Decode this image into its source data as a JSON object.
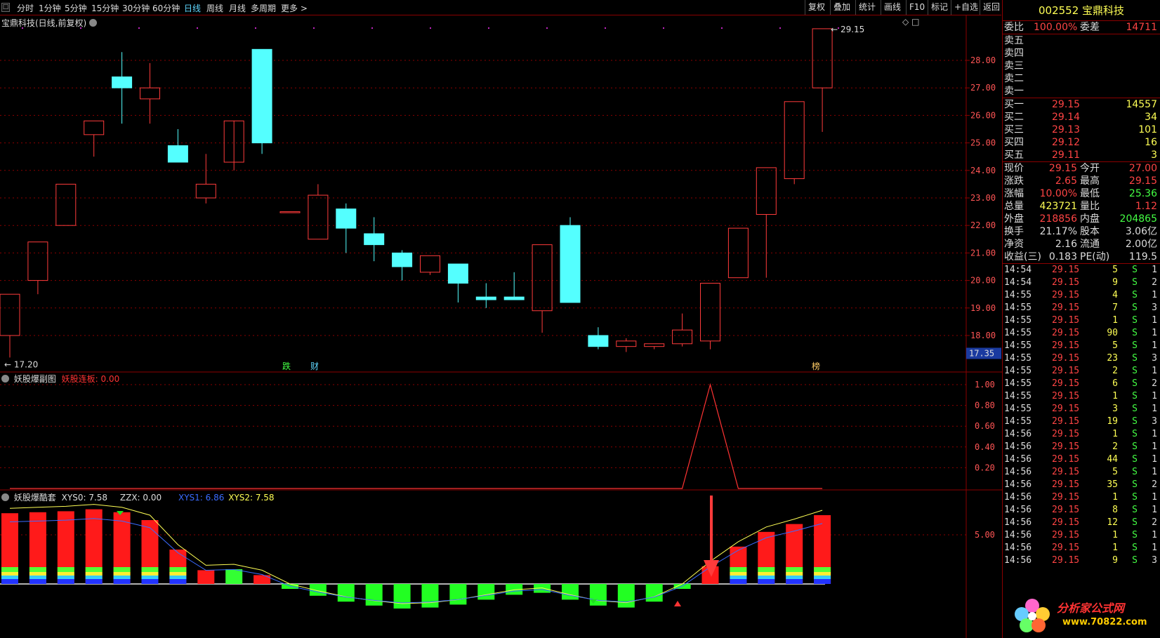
{
  "toolbar": {
    "grip": "□",
    "periods": [
      {
        "label": "分时",
        "active": false
      },
      {
        "label": "1分钟",
        "active": false
      },
      {
        "label": "5分钟",
        "active": false
      },
      {
        "label": "15分钟",
        "active": false
      },
      {
        "label": "30分钟",
        "active": false
      },
      {
        "label": "60分钟",
        "active": false
      },
      {
        "label": "日线",
        "active": true
      },
      {
        "label": "周线",
        "active": false
      },
      {
        "label": "月线",
        "active": false
      },
      {
        "label": "多周期",
        "active": false
      },
      {
        "label": "更多 >",
        "active": false
      }
    ],
    "tools": [
      "复权",
      "叠加",
      "统计",
      "画线",
      "F10",
      "标记",
      "+自选",
      "返回"
    ]
  },
  "main_chart": {
    "title": "宝鼎科技(日线,前复权)",
    "price_ticks": [
      "28.00",
      "27.00",
      "26.00",
      "25.00",
      "24.00",
      "23.00",
      "22.00",
      "21.00",
      "20.00",
      "19.00",
      "18.00"
    ],
    "current_price_tag": "17.35",
    "high_label": "29.15",
    "low_label": "17.20",
    "markers": [
      {
        "text": "跌",
        "color": "#44ff44"
      },
      {
        "text": "财",
        "color": "#5fd7ff"
      },
      {
        "text": "榜",
        "color": "#ffcc66"
      }
    ],
    "corner_icons": [
      "◇",
      "□"
    ]
  },
  "sub_chart1": {
    "name": "妖股爆副图",
    "series_label": "妖股连板: 0.00",
    "ticks": [
      "1.00",
      "0.80",
      "0.60",
      "0.40",
      "0.20"
    ]
  },
  "sub_chart2": {
    "name": "妖股爆酷套",
    "xys0": "XYS0: 7.58",
    "zzx": "ZZX: 0.00",
    "xys1": "XYS1: 6.86",
    "xys2": "XYS2: 7.58",
    "ticks": [
      "5.00"
    ]
  },
  "colors": {
    "up": "#ff3b3b",
    "down": "#54ffff",
    "grid": "#8b0000",
    "axis_text": "#ff5555"
  },
  "chart_data": {
    "type": "candlestick",
    "title": "宝鼎科技(日线,前复权)",
    "ylim": [
      17.0,
      29.5
    ],
    "candles": [
      {
        "o": 18.0,
        "h": 19.5,
        "l": 17.2,
        "c": 19.5
      },
      {
        "o": 20.0,
        "h": 21.4,
        "l": 19.5,
        "c": 21.4
      },
      {
        "o": 22.0,
        "h": 23.5,
        "l": 22.0,
        "c": 23.5
      },
      {
        "o": 25.3,
        "h": 25.8,
        "l": 24.5,
        "c": 25.8
      },
      {
        "o": 27.4,
        "h": 28.3,
        "l": 25.7,
        "c": 27.0
      },
      {
        "o": 26.6,
        "h": 27.9,
        "l": 25.7,
        "c": 27.0
      },
      {
        "o": 24.9,
        "h": 25.5,
        "l": 24.3,
        "c": 24.3
      },
      {
        "o": 23.0,
        "h": 24.6,
        "l": 22.8,
        "c": 23.5
      },
      {
        "o": 24.3,
        "h": 24.3,
        "l": 24.0,
        "c": 25.8
      },
      {
        "o": 28.4,
        "h": 28.4,
        "l": 24.6,
        "c": 25.0
      },
      {
        "o": 22.5,
        "h": 22.5,
        "l": 22.5,
        "c": 22.5
      },
      {
        "o": 21.5,
        "h": 23.5,
        "l": 21.5,
        "c": 23.1
      },
      {
        "o": 22.6,
        "h": 22.8,
        "l": 21.0,
        "c": 21.9
      },
      {
        "o": 21.7,
        "h": 22.3,
        "l": 20.7,
        "c": 21.3
      },
      {
        "o": 21.0,
        "h": 21.1,
        "l": 20.0,
        "c": 20.5
      },
      {
        "o": 20.3,
        "h": 20.9,
        "l": 20.2,
        "c": 20.9
      },
      {
        "o": 20.6,
        "h": 20.6,
        "l": 19.2,
        "c": 19.9
      },
      {
        "o": 19.4,
        "h": 19.9,
        "l": 19.0,
        "c": 19.3
      },
      {
        "o": 19.4,
        "h": 20.3,
        "l": 19.3,
        "c": 19.3
      },
      {
        "o": 18.9,
        "h": 21.3,
        "l": 18.1,
        "c": 21.3
      },
      {
        "o": 22.0,
        "h": 22.3,
        "l": 19.2,
        "c": 19.2
      },
      {
        "o": 18.0,
        "h": 18.3,
        "l": 17.5,
        "c": 17.6
      },
      {
        "o": 17.6,
        "h": 17.9,
        "l": 17.4,
        "c": 17.8
      },
      {
        "o": 17.6,
        "h": 17.7,
        "l": 17.5,
        "c": 17.7
      },
      {
        "o": 17.7,
        "h": 18.8,
        "l": 17.6,
        "c": 18.2
      },
      {
        "o": 17.8,
        "h": 19.9,
        "l": 17.5,
        "c": 19.9
      },
      {
        "o": 20.1,
        "h": 21.9,
        "l": 20.1,
        "c": 21.9
      },
      {
        "o": 22.4,
        "h": 24.1,
        "l": 20.1,
        "c": 24.1
      },
      {
        "o": 23.7,
        "h": 26.5,
        "l": 23.5,
        "c": 26.5
      },
      {
        "o": 27.0,
        "h": 29.15,
        "l": 25.4,
        "c": 29.15
      }
    ],
    "sub1_line": [
      0,
      0,
      0,
      0,
      0,
      0,
      0,
      0,
      0,
      0,
      0,
      0,
      0,
      0,
      0,
      0,
      0,
      0,
      0,
      0,
      0,
      0,
      0,
      0,
      0,
      1.0,
      0,
      0,
      0,
      0
    ],
    "sub2_bars": [
      {
        "v": 7.2,
        "color": "red"
      },
      {
        "v": 7.3,
        "color": "red"
      },
      {
        "v": 7.4,
        "color": "red"
      },
      {
        "v": 7.6,
        "color": "red"
      },
      {
        "v": 7.3,
        "color": "red"
      },
      {
        "v": 6.5,
        "color": "red"
      },
      {
        "v": 3.5,
        "color": "red"
      },
      {
        "v": 1.4,
        "color": "red"
      },
      {
        "v": 1.5,
        "color": "green"
      },
      {
        "v": 0.9,
        "color": "red"
      },
      {
        "v": -0.5,
        "color": "green"
      },
      {
        "v": -1.2,
        "color": "green"
      },
      {
        "v": -1.8,
        "color": "green"
      },
      {
        "v": -2.2,
        "color": "green"
      },
      {
        "v": -2.5,
        "color": "green"
      },
      {
        "v": -2.4,
        "color": "green"
      },
      {
        "v": -2.1,
        "color": "green"
      },
      {
        "v": -1.6,
        "color": "green"
      },
      {
        "v": -1.1,
        "color": "green"
      },
      {
        "v": -0.9,
        "color": "green"
      },
      {
        "v": -1.6,
        "color": "green"
      },
      {
        "v": -2.2,
        "color": "green"
      },
      {
        "v": -2.4,
        "color": "green"
      },
      {
        "v": -1.8,
        "color": "green"
      },
      {
        "v": -0.5,
        "color": "green"
      },
      {
        "v": 1.8,
        "color": "red"
      },
      {
        "v": 3.8,
        "color": "red"
      },
      {
        "v": 5.3,
        "color": "red"
      },
      {
        "v": 6.1,
        "color": "red"
      },
      {
        "v": 7.0,
        "color": "red"
      }
    ]
  },
  "quote": {
    "title": "002552 宝鼎科技",
    "weibi_label": "委比",
    "weibi": "100.00%",
    "weicha_label": "委差",
    "weicha": "14711",
    "asks": [
      {
        "label": "卖五",
        "price": "",
        "vol": ""
      },
      {
        "label": "卖四",
        "price": "",
        "vol": ""
      },
      {
        "label": "卖三",
        "price": "",
        "vol": ""
      },
      {
        "label": "卖二",
        "price": "",
        "vol": ""
      },
      {
        "label": "卖一",
        "price": "",
        "vol": ""
      }
    ],
    "bids": [
      {
        "label": "买一",
        "price": "29.15",
        "vol": "14557"
      },
      {
        "label": "买二",
        "price": "29.14",
        "vol": "34"
      },
      {
        "label": "买三",
        "price": "29.13",
        "vol": "101"
      },
      {
        "label": "买四",
        "price": "29.12",
        "vol": "16"
      },
      {
        "label": "买五",
        "price": "29.11",
        "vol": "3"
      }
    ],
    "stats": [
      {
        "l1": "现价",
        "v1": "29.15",
        "c1": "red",
        "l2": "今开",
        "v2": "27.00",
        "c2": "red"
      },
      {
        "l1": "涨跌",
        "v1": "2.65",
        "c1": "red",
        "l2": "最高",
        "v2": "29.15",
        "c2": "red"
      },
      {
        "l1": "涨幅",
        "v1": "10.00%",
        "c1": "red",
        "l2": "最低",
        "v2": "25.36",
        "c2": "green"
      },
      {
        "l1": "总量",
        "v1": "423721",
        "c1": "yellow",
        "l2": "量比",
        "v2": "1.12",
        "c2": "red"
      },
      {
        "l1": "外盘",
        "v1": "218856",
        "c1": "red",
        "l2": "内盘",
        "v2": "204865",
        "c2": "green"
      },
      {
        "l1": "换手",
        "v1": "21.17%",
        "c1": "white",
        "l2": "股本",
        "v2": "3.06亿",
        "c2": "white"
      },
      {
        "l1": "净资",
        "v1": "2.16",
        "c1": "white",
        "l2": "流通",
        "v2": "2.00亿",
        "c2": "white"
      },
      {
        "l1": "收益(三)",
        "v1": "0.183",
        "c1": "white",
        "l2": "PE(动)",
        "v2": "119.5",
        "c2": "white"
      }
    ],
    "ticks": [
      {
        "t": "14:54",
        "p": "29.15",
        "v": "5",
        "s": "S",
        "n": "1"
      },
      {
        "t": "14:54",
        "p": "29.15",
        "v": "9",
        "s": "S",
        "n": "2"
      },
      {
        "t": "14:55",
        "p": "29.15",
        "v": "4",
        "s": "S",
        "n": "1"
      },
      {
        "t": "14:55",
        "p": "29.15",
        "v": "7",
        "s": "S",
        "n": "3"
      },
      {
        "t": "14:55",
        "p": "29.15",
        "v": "1",
        "s": "S",
        "n": "1"
      },
      {
        "t": "14:55",
        "p": "29.15",
        "v": "90",
        "s": "S",
        "n": "1"
      },
      {
        "t": "14:55",
        "p": "29.15",
        "v": "5",
        "s": "S",
        "n": "1"
      },
      {
        "t": "14:55",
        "p": "29.15",
        "v": "23",
        "s": "S",
        "n": "3"
      },
      {
        "t": "14:55",
        "p": "29.15",
        "v": "2",
        "s": "S",
        "n": "1"
      },
      {
        "t": "14:55",
        "p": "29.15",
        "v": "6",
        "s": "S",
        "n": "2"
      },
      {
        "t": "14:55",
        "p": "29.15",
        "v": "1",
        "s": "S",
        "n": "1"
      },
      {
        "t": "14:55",
        "p": "29.15",
        "v": "3",
        "s": "S",
        "n": "1"
      },
      {
        "t": "14:55",
        "p": "29.15",
        "v": "19",
        "s": "S",
        "n": "3"
      },
      {
        "t": "14:56",
        "p": "29.15",
        "v": "1",
        "s": "S",
        "n": "1"
      },
      {
        "t": "14:56",
        "p": "29.15",
        "v": "2",
        "s": "S",
        "n": "1"
      },
      {
        "t": "14:56",
        "p": "29.15",
        "v": "44",
        "s": "S",
        "n": "1"
      },
      {
        "t": "14:56",
        "p": "29.15",
        "v": "5",
        "s": "S",
        "n": "1"
      },
      {
        "t": "14:56",
        "p": "29.15",
        "v": "35",
        "s": "S",
        "n": "2"
      },
      {
        "t": "14:56",
        "p": "29.15",
        "v": "1",
        "s": "S",
        "n": "1"
      },
      {
        "t": "14:56",
        "p": "29.15",
        "v": "8",
        "s": "S",
        "n": "1"
      },
      {
        "t": "14:56",
        "p": "29.15",
        "v": "12",
        "s": "S",
        "n": "2"
      },
      {
        "t": "14:56",
        "p": "29.15",
        "v": "1",
        "s": "S",
        "n": "1"
      },
      {
        "t": "14:56",
        "p": "29.15",
        "v": "1",
        "s": "S",
        "n": "1"
      },
      {
        "t": "14:56",
        "p": "29.15",
        "v": "9",
        "s": "S",
        "n": "3"
      }
    ]
  },
  "watermark": {
    "text": "分析家公式网",
    "url": "www.70822.com"
  }
}
